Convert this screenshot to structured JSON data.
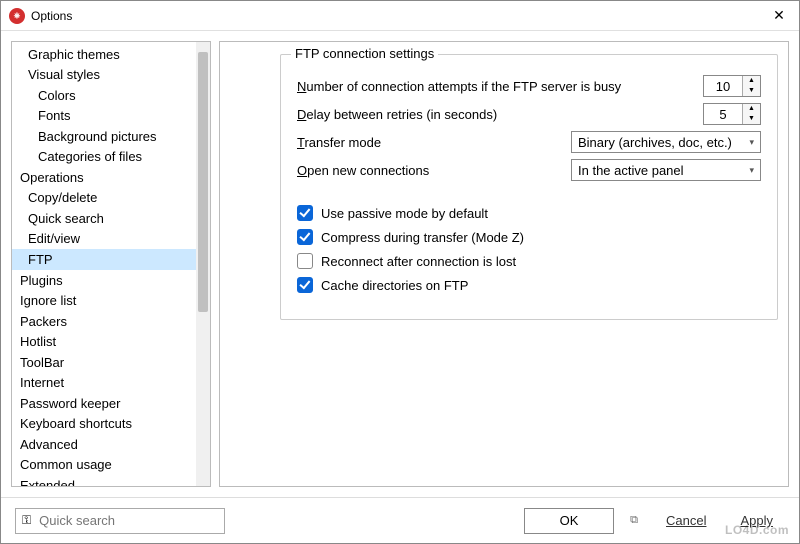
{
  "titlebar": {
    "title": "Options"
  },
  "sidebar": {
    "items": [
      {
        "label": "Graphic themes",
        "level": 1,
        "selected": false
      },
      {
        "label": "Visual styles",
        "level": 1,
        "selected": false
      },
      {
        "label": "Colors",
        "level": 2,
        "selected": false
      },
      {
        "label": "Fonts",
        "level": 2,
        "selected": false
      },
      {
        "label": "Background pictures",
        "level": 2,
        "selected": false
      },
      {
        "label": "Categories of files",
        "level": 2,
        "selected": false
      },
      {
        "label": "Operations",
        "level": 0,
        "selected": false
      },
      {
        "label": "Copy/delete",
        "level": 1,
        "selected": false
      },
      {
        "label": "Quick search",
        "level": 1,
        "selected": false
      },
      {
        "label": "Edit/view",
        "level": 1,
        "selected": false
      },
      {
        "label": "FTP",
        "level": 1,
        "selected": true
      },
      {
        "label": "Plugins",
        "level": 0,
        "selected": false
      },
      {
        "label": "Ignore list",
        "level": 0,
        "selected": false
      },
      {
        "label": "Packers",
        "level": 0,
        "selected": false
      },
      {
        "label": "Hotlist",
        "level": 0,
        "selected": false
      },
      {
        "label": "ToolBar",
        "level": 0,
        "selected": false
      },
      {
        "label": "Internet",
        "level": 0,
        "selected": false
      },
      {
        "label": "Password keeper",
        "level": 0,
        "selected": false
      },
      {
        "label": "Keyboard shortcuts",
        "level": 0,
        "selected": false
      },
      {
        "label": "Advanced",
        "level": 0,
        "selected": false
      },
      {
        "label": "Common usage",
        "level": 0,
        "selected": false
      },
      {
        "label": "Extended",
        "level": 0,
        "selected": false
      }
    ]
  },
  "panel": {
    "group_title": "FTP connection settings",
    "attempts_label_pre": "N",
    "attempts_label_post": "umber of connection attempts if the FTP server is busy",
    "attempts_value": "10",
    "delay_label_pre": "D",
    "delay_label_post": "elay between retries (in seconds)",
    "delay_value": "5",
    "transfer_label_pre": "T",
    "transfer_label_post": "ransfer mode",
    "transfer_value": "Binary (archives, doc, etc.)",
    "open_label_pre": "O",
    "open_label_post": "pen new connections",
    "open_value": "In the active panel",
    "checks": [
      {
        "label": "Use passive mode by default",
        "checked": true
      },
      {
        "label": "Compress during transfer (Mode Z)",
        "checked": true
      },
      {
        "label": "Reconnect after connection is lost",
        "checked": false
      },
      {
        "label": "Cache directories on FTP",
        "checked": true
      }
    ]
  },
  "footer": {
    "search_placeholder": "Quick search",
    "ok": "OK",
    "cancel": "Cancel",
    "apply": "Apply"
  },
  "watermark": "LO4D.com"
}
